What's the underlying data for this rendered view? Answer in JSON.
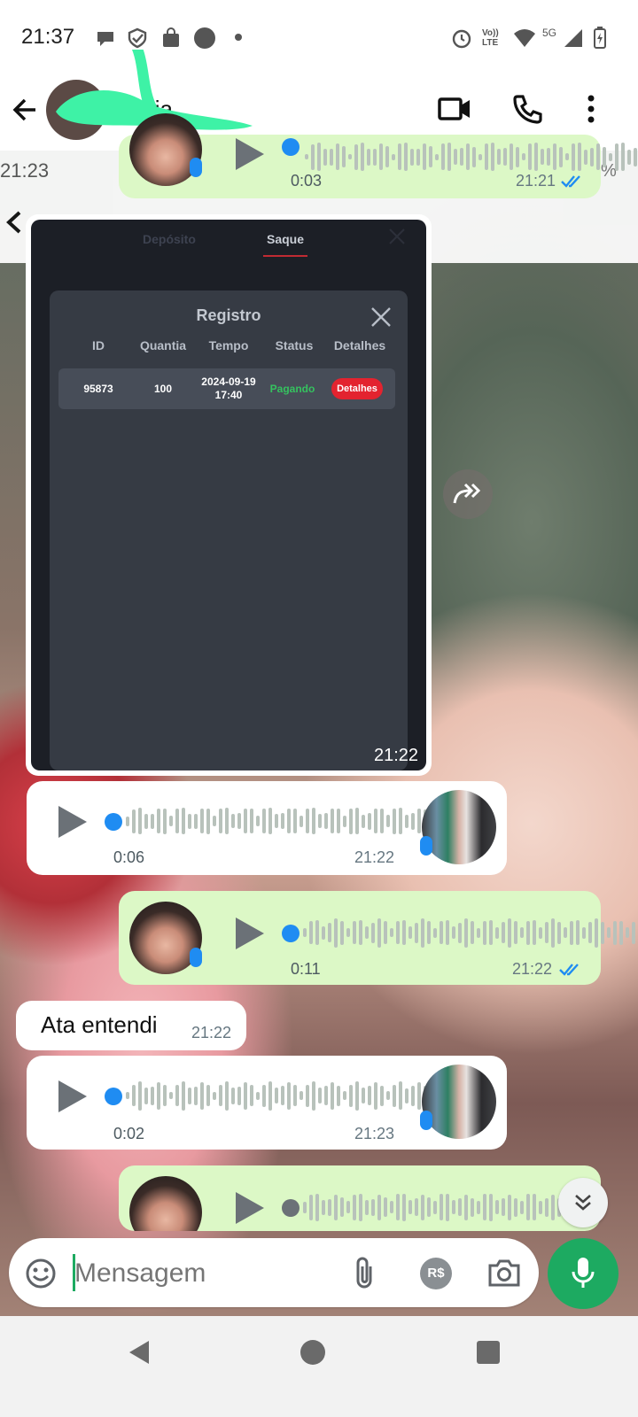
{
  "status_bar": {
    "time": "21:37",
    "network": "5G",
    "volte": "Vo)) LTE"
  },
  "header": {
    "contact_name": "Maria"
  },
  "background_strip": {
    "time": "21:23",
    "battery_suffix": "%"
  },
  "deposit_app": {
    "tabs": [
      "Depósito",
      "Saque"
    ],
    "active_tab": "Saque",
    "modal_title": "Registro",
    "columns": [
      "ID",
      "Quantia",
      "Tempo",
      "Status",
      "Detalhes"
    ],
    "rows": [
      {
        "id": "95873",
        "amount": "100",
        "time": "2024-09-19 17:40",
        "status": "Pagando",
        "details": "Detalhes"
      }
    ],
    "image_timestamp": "21:22"
  },
  "messages": [
    {
      "type": "voice",
      "direction": "out",
      "duration": "0:03",
      "time": "21:21"
    },
    {
      "type": "voice",
      "direction": "in",
      "duration": "0:06",
      "time": "21:22"
    },
    {
      "type": "voice",
      "direction": "out",
      "duration": "0:11",
      "time": "21:22"
    },
    {
      "type": "text",
      "direction": "in",
      "text": "Ata entendi",
      "time": "21:22"
    },
    {
      "type": "voice",
      "direction": "in",
      "duration": "0:02",
      "time": "21:23"
    }
  ],
  "composer": {
    "placeholder": "Mensagem",
    "currency": "R$"
  },
  "colors": {
    "outgoing_bubble": "#dcf8c6",
    "incoming_bubble": "#ffffff",
    "accent_green": "#1daa61",
    "read_ticks": "#1f8cf2",
    "status_pagando": "#35c25f",
    "details_button": "#e3232f"
  },
  "icons": [
    "back-arrow",
    "video-call",
    "phone-call",
    "more-vertical",
    "forward",
    "scroll-down",
    "emoji",
    "attach",
    "camera",
    "mic",
    "nav-back",
    "nav-home",
    "nav-recents"
  ]
}
